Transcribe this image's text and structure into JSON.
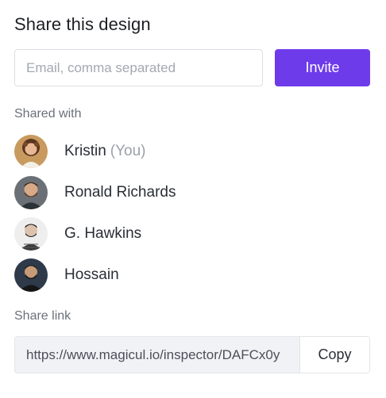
{
  "dialog": {
    "title": "Share this design"
  },
  "invite": {
    "placeholder": "Email, comma separated",
    "value": "",
    "button_label": "Invite",
    "accent_color": "#6e3bea"
  },
  "shared_with": {
    "label": "Shared with",
    "members": [
      {
        "name": "Kristin",
        "suffix": "(You)",
        "avatar_icon": "avatar-kristin"
      },
      {
        "name": "Ronald Richards",
        "suffix": "",
        "avatar_icon": "avatar-ronald"
      },
      {
        "name": "G. Hawkins",
        "suffix": "",
        "avatar_icon": "avatar-hawkins"
      },
      {
        "name": "Hossain",
        "suffix": "",
        "avatar_icon": "avatar-hossain"
      }
    ]
  },
  "share_link": {
    "label": "Share link",
    "url": "https://www.magicul.io/inspector/DAFCx0y",
    "copy_label": "Copy"
  }
}
